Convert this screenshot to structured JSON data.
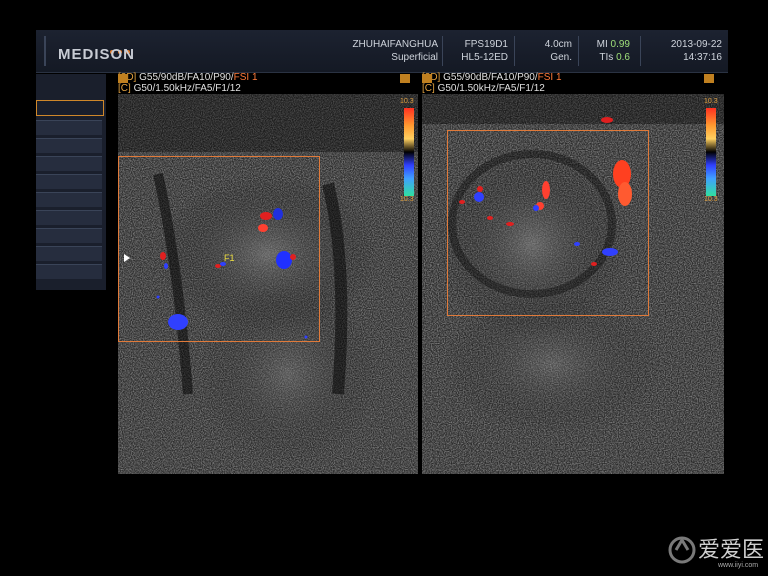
{
  "header": {
    "brand": "MEDISON",
    "institution": "ZHUHAIFANGHUA",
    "preset": "Superficial",
    "frame_rate": "FPS19D1",
    "probe": "HL5-12ED",
    "depth": "4.0cm",
    "mode": "Gen.",
    "mi_label": "MI",
    "mi_value": "0.99",
    "tis_label": "TIs",
    "tis_value": "0.6",
    "date": "2013-09-22",
    "time": "14:37:16"
  },
  "left_panel": {
    "line_2d_tag": "[2D]",
    "line_2d": "G55/90dB/FA10/P90/",
    "line_2d_fsi": "FSI 1",
    "line_c_tag": "[C]",
    "line_c": "G50/1.50kHz/FA5/F1/12",
    "scale_top": "10.3",
    "scale_bottom": "10.3",
    "focus_marker": "F1"
  },
  "right_panel": {
    "line_2d_tag": "[2D]",
    "line_2d": "G55/90dB/FA10/P90/",
    "line_2d_fsi": "FSI 1",
    "line_c_tag": "[C]",
    "line_c": "G50/1.50kHz/FA5/F1/12",
    "scale_top": "10.3",
    "scale_bottom": "10.3"
  },
  "side_menu": {
    "selected_index": 0,
    "item_count": 10
  },
  "watermark": {
    "text": "爱爱医",
    "url": "www.iiyi.com"
  },
  "colors": {
    "roi": "#e07a3a",
    "accent": "#e0a040",
    "mi_value": "#9fe07a"
  }
}
